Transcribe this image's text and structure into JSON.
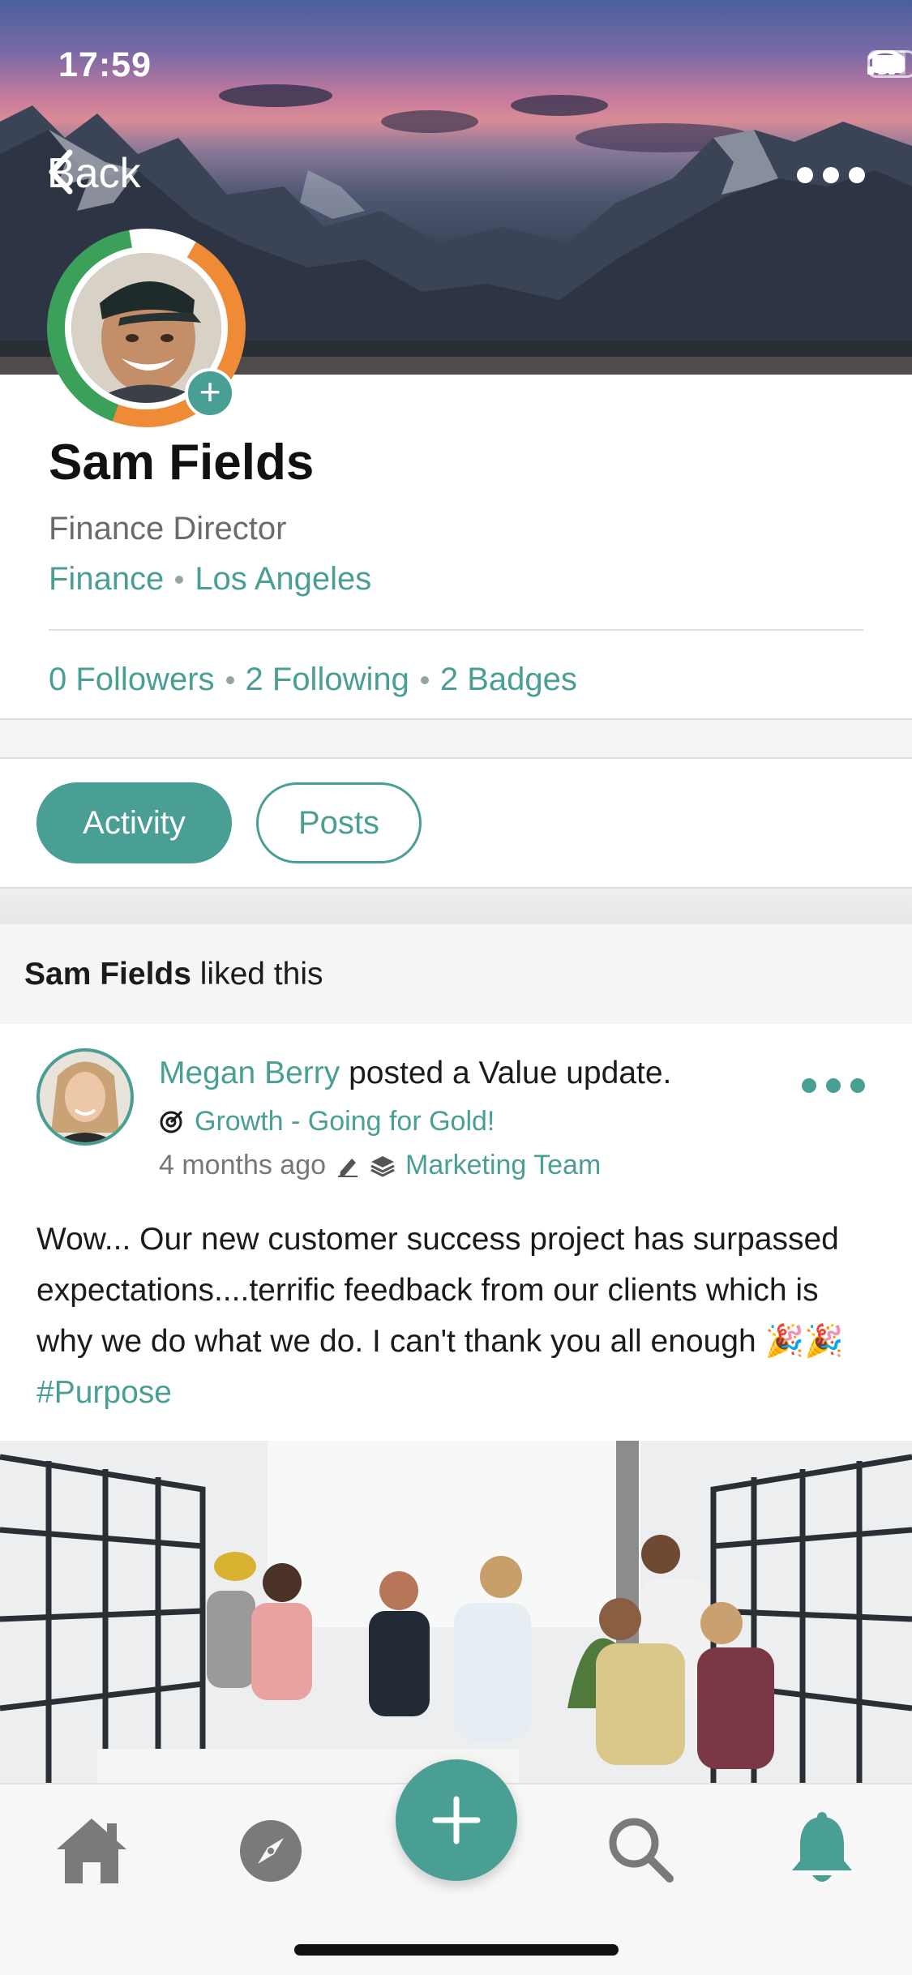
{
  "status_bar": {
    "time": "17:59"
  },
  "nav": {
    "back_label": "Back"
  },
  "profile": {
    "name": "Sam Fields",
    "title": "Finance Director",
    "department": "Finance",
    "location": "Los Angeles",
    "followers": "0 Followers",
    "following": "2 Following",
    "badges": "2 Badges"
  },
  "tabs": [
    {
      "label": "Activity",
      "active": true
    },
    {
      "label": "Posts",
      "active": false
    }
  ],
  "feed": {
    "liked_name": "Sam Fields",
    "liked_suffix": " liked this",
    "post": {
      "author": "Megan Berry",
      "action": " posted a Value update.",
      "value": "Growth - Going for Gold!",
      "time": "4 months ago",
      "team": "Marketing Team",
      "body": "Wow... Our new customer success project has surpassed expectations....terrific feedback from our clients which is why we do what we do. I can't thank you all enough 🎉🎉 ",
      "hashtag": "#Purpose"
    }
  },
  "tabbar": {
    "items": [
      "home-icon",
      "explore-icon",
      "add-icon",
      "search-icon",
      "notifications-icon"
    ]
  },
  "colors": {
    "accent": "#4a9f95",
    "ring_green": "#3aa05a",
    "ring_orange": "#ef8a36"
  }
}
